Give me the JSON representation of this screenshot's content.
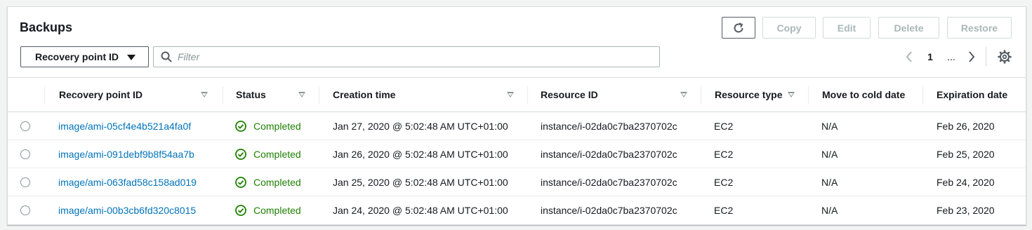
{
  "header": {
    "title": "Backups",
    "buttons": {
      "copy": "Copy",
      "edit": "Edit",
      "delete": "Delete",
      "restore": "Restore"
    },
    "property_selector": "Recovery point ID",
    "filter_placeholder": "Filter",
    "pagination": {
      "current_page": "1",
      "ellipsis": "..."
    }
  },
  "columns": [
    "Recovery point ID",
    "Status",
    "Creation time",
    "Resource ID",
    "Resource type",
    "Move to cold date",
    "Expiration date"
  ],
  "rows": [
    {
      "recovery_point_id": "image/ami-05cf4e4b521a4fa0f",
      "status": "Completed",
      "creation_time": "Jan 27, 2020 @ 5:02:48 AM UTC+01:00",
      "resource_id": "instance/i-02da0c7ba2370702c",
      "resource_type": "EC2",
      "move_to_cold_date": "N/A",
      "expiration_date": "Feb 26, 2020"
    },
    {
      "recovery_point_id": "image/ami-091debf9b8f54aa7b",
      "status": "Completed",
      "creation_time": "Jan 26, 2020 @ 5:02:48 AM UTC+01:00",
      "resource_id": "instance/i-02da0c7ba2370702c",
      "resource_type": "EC2",
      "move_to_cold_date": "N/A",
      "expiration_date": "Feb 25, 2020"
    },
    {
      "recovery_point_id": "image/ami-063fad58c158ad019",
      "status": "Completed",
      "creation_time": "Jan 25, 2020 @ 5:02:48 AM UTC+01:00",
      "resource_id": "instance/i-02da0c7ba2370702c",
      "resource_type": "EC2",
      "move_to_cold_date": "N/A",
      "expiration_date": "Feb 24, 2020"
    },
    {
      "recovery_point_id": "image/ami-00b3cb6fd320c8015",
      "status": "Completed",
      "creation_time": "Jan 24, 2020 @ 5:02:48 AM UTC+01:00",
      "resource_id": "instance/i-02da0c7ba2370702c",
      "resource_type": "EC2",
      "move_to_cold_date": "N/A",
      "expiration_date": "Feb 23, 2020"
    }
  ],
  "colors": {
    "link": "#0073bb",
    "success": "#1d8102",
    "disabled": "#aab7b8"
  },
  "icons": [
    "refresh-icon",
    "caret-down-icon",
    "search-icon",
    "chevron-left-icon",
    "chevron-right-icon",
    "gear-icon",
    "status-success-icon",
    "sort-icon"
  ]
}
